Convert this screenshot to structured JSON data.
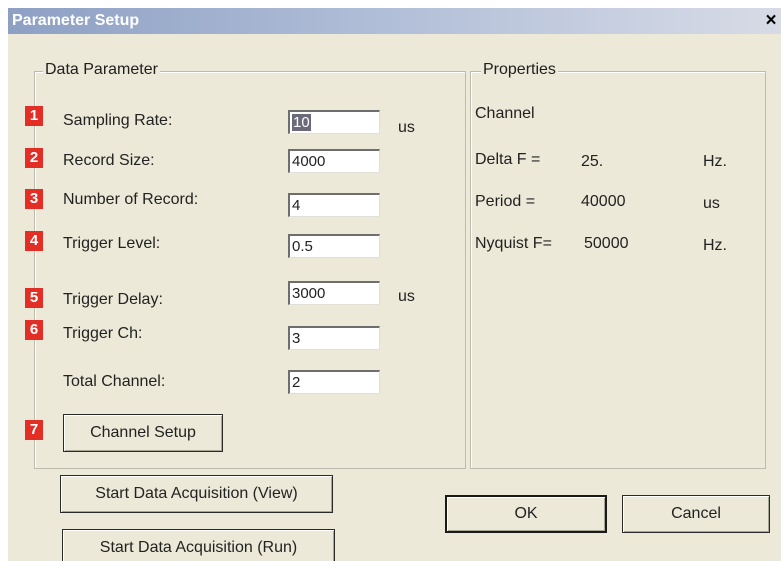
{
  "window": {
    "title": "Parameter Setup",
    "close_glyph": "×"
  },
  "data_parameter": {
    "legend": "Data Parameter",
    "fields": [
      {
        "marker": "1",
        "label": "Sampling Rate:",
        "value": "10",
        "unit": "us"
      },
      {
        "marker": "2",
        "label": "Record Size:",
        "value": "4000",
        "unit": ""
      },
      {
        "marker": "3",
        "label": "Number of Record:",
        "value": "4",
        "unit": ""
      },
      {
        "marker": "4",
        "label": "Trigger Level:",
        "value": "0.5",
        "unit": ""
      },
      {
        "marker": "5",
        "label": "Trigger Delay:",
        "value": "3000",
        "unit": "us"
      },
      {
        "marker": "6",
        "label": "Trigger Ch:",
        "value": "3",
        "unit": ""
      },
      {
        "marker": "",
        "label": "Total Channel:",
        "value": "2",
        "unit": ""
      }
    ],
    "channel_setup": {
      "marker": "7",
      "label": "Channel Setup"
    }
  },
  "properties": {
    "legend": "Properties",
    "channel_label": "Channel",
    "rows": [
      {
        "label": "Delta F =",
        "value": "25.",
        "unit": "Hz."
      },
      {
        "label": "Period =",
        "value": "40000",
        "unit": "us"
      },
      {
        "label": "Nyquist F=",
        "value": "50000",
        "unit": "Hz."
      }
    ]
  },
  "buttons": {
    "start_view": "Start Data Acquisition (View)",
    "start_run": "Start Data Acquisition (Run)",
    "ok": "OK",
    "cancel": "Cancel"
  },
  "colors": {
    "marker": "#e32e26",
    "dialog_bg": "#ece9d8",
    "titlebar": "#8da0c4"
  }
}
